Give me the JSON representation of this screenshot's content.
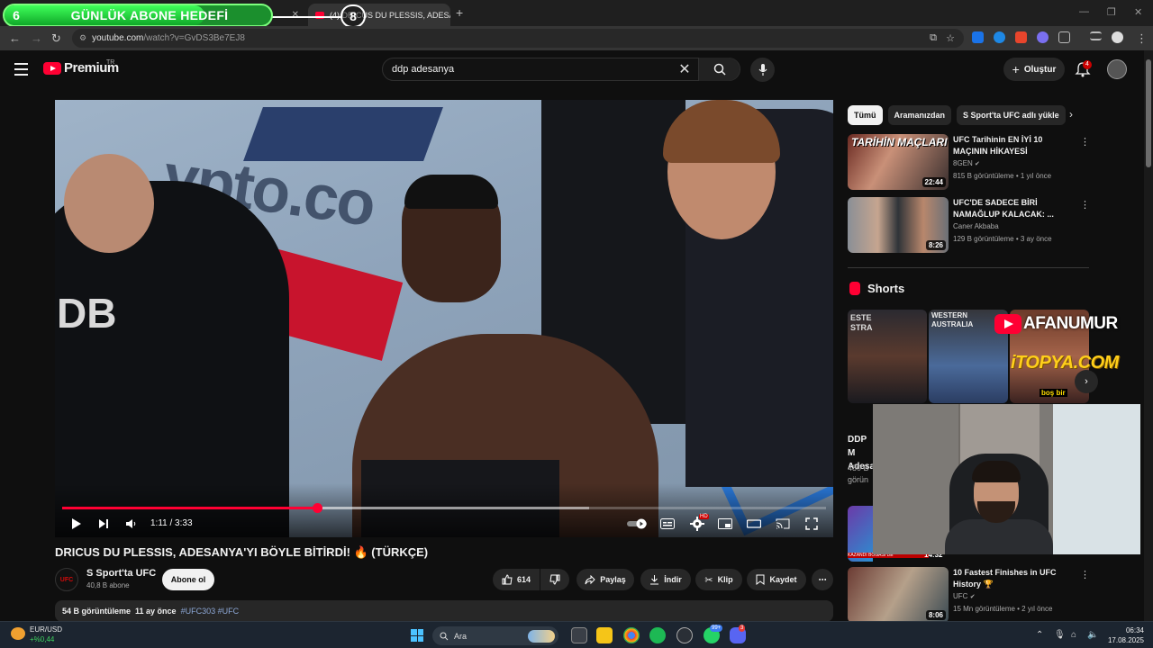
{
  "overlay": {
    "sub_goal_current": "6",
    "sub_goal_label": "GÜNLÜK ABONE HEDEFİ",
    "sub_goal_target": "8",
    "sub_goal_progress_fraction": 0.75
  },
  "browser": {
    "tabs": [
      {
        "title": "s v",
        "active": false
      },
      {
        "title": "(4) DRICUS DU PLESSIS, ADESANYA",
        "active": true
      }
    ],
    "url_domain": "youtube.com",
    "url_path": "/watch?v=GvDS3Be7EJ8"
  },
  "youtube": {
    "brand": "Premium",
    "region": "TR",
    "search_query": "ddp adesanya",
    "create_label": "Oluştur",
    "notification_count": "4"
  },
  "player": {
    "time": "1:11 / 3:33",
    "progress_fraction": 0.3333,
    "buffer_fraction": 0.69,
    "overlay_text": "ypto.co",
    "ref_text": "DB",
    "hd_badge": "HD"
  },
  "video": {
    "title": "DRICUS DU PLESSIS, ADESANYA'YI BÖYLE BİTİRDİ! 🔥 (TÜRKÇE)",
    "channel_name": "S Sport'ta UFC",
    "channel_avatar_text": "UFC",
    "subscribers": "40,8 B abone",
    "subscribe_label": "Abone ol",
    "likes": "614",
    "share_label": "Paylaş",
    "download_label": "İndir",
    "clip_label": "Klip",
    "save_label": "Kaydet",
    "views": "54 B görüntüleme",
    "date": "11 ay önce",
    "tags": "#UFC303 #UFC"
  },
  "sidebar": {
    "chips": [
      {
        "label": "Tümü",
        "active": true
      },
      {
        "label": "Aramanızdan",
        "active": false
      },
      {
        "label": "S Sport'ta UFC adlı yükle",
        "active": false
      }
    ],
    "recs": [
      {
        "title": "UFC Tarihinin EN İYİ 10 MAÇININ HİKAYESİ",
        "channel": "8GEN",
        "verified": true,
        "meta": "815 B görüntüleme • 1 yıl önce",
        "duration": "22:44",
        "thumb_text": "TARİHİN MAÇLARI"
      },
      {
        "title": "UFC'DE SADECE BİRİ NAMAĞLUP KALACAK: ...",
        "channel": "Caner Akbaba",
        "verified": false,
        "meta": "129 B görüntüleme • 3 ay önce",
        "duration": "8:26"
      }
    ],
    "shorts_header": "Shorts",
    "short_cards": [
      {
        "label": "ESTE STRA"
      },
      {
        "label": "WESTERN AUSTRALIA"
      },
      {
        "label": "boş bir"
      }
    ],
    "short_title_fragment": "DDP M Adesa",
    "short_meta_fragment": "480 B görün",
    "lower_recs": [
      {
        "title": "10 Fastest Finishes in UFC History 🏆",
        "channel": "UFC",
        "verified": true,
        "meta": "15 Mn görüntüleme • 2 yıl önce",
        "duration": "8:06"
      }
    ],
    "partial_thumb_text": "KAZANDI BOĞASI DE",
    "partial_duration": "14:32"
  },
  "stream_overlays": {
    "afanumur": "AFANUMUR",
    "itopya": "iTOPYA.COM"
  },
  "taskbar": {
    "ticker_symbol": "EUR/USD",
    "ticker_change": "+%0,44",
    "search_placeholder": "Ara",
    "time": "06:34",
    "date": "17.08.2025",
    "badge_99": "99+",
    "badge_discord": "3"
  }
}
